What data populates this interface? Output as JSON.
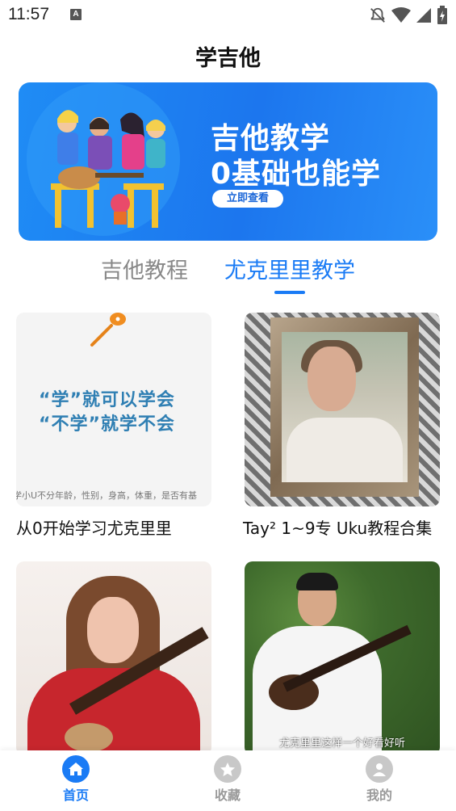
{
  "status_bar": {
    "time": "11:57",
    "notification_badge": "A",
    "icons": [
      "notifications-off-icon",
      "wifi-icon",
      "cell-signal-icon",
      "battery-icon"
    ]
  },
  "header": {
    "title": "学吉他"
  },
  "banner": {
    "line1": "吉他教学",
    "line2": "0基础也能学",
    "button_label": "立即查看"
  },
  "tabs": [
    {
      "label": "吉他教程",
      "active": false
    },
    {
      "label": "尤克里里教学",
      "active": true
    }
  ],
  "cards": [
    {
      "title": "从0开始学习尤克里里",
      "thumb_line1": "“学”就可以学会",
      "thumb_line2": "“不学”就学不会",
      "thumb_small": "学小U不分年龄，性别，身高，体重，是否有基"
    },
    {
      "title": "Tay² 1~9专 Uku教程合集"
    },
    {
      "title": ""
    },
    {
      "title": "",
      "thumb_caption": "尤克里里这样一个好看好听"
    }
  ],
  "bottom_nav": [
    {
      "label": "首页",
      "icon": "home-icon",
      "active": true
    },
    {
      "label": "收藏",
      "icon": "star-icon",
      "active": false
    },
    {
      "label": "我的",
      "icon": "user-icon",
      "active": false
    }
  ],
  "colors": {
    "accent": "#1a7bf5",
    "inactive": "#9a9a9a",
    "banner": "#1c76ee"
  }
}
